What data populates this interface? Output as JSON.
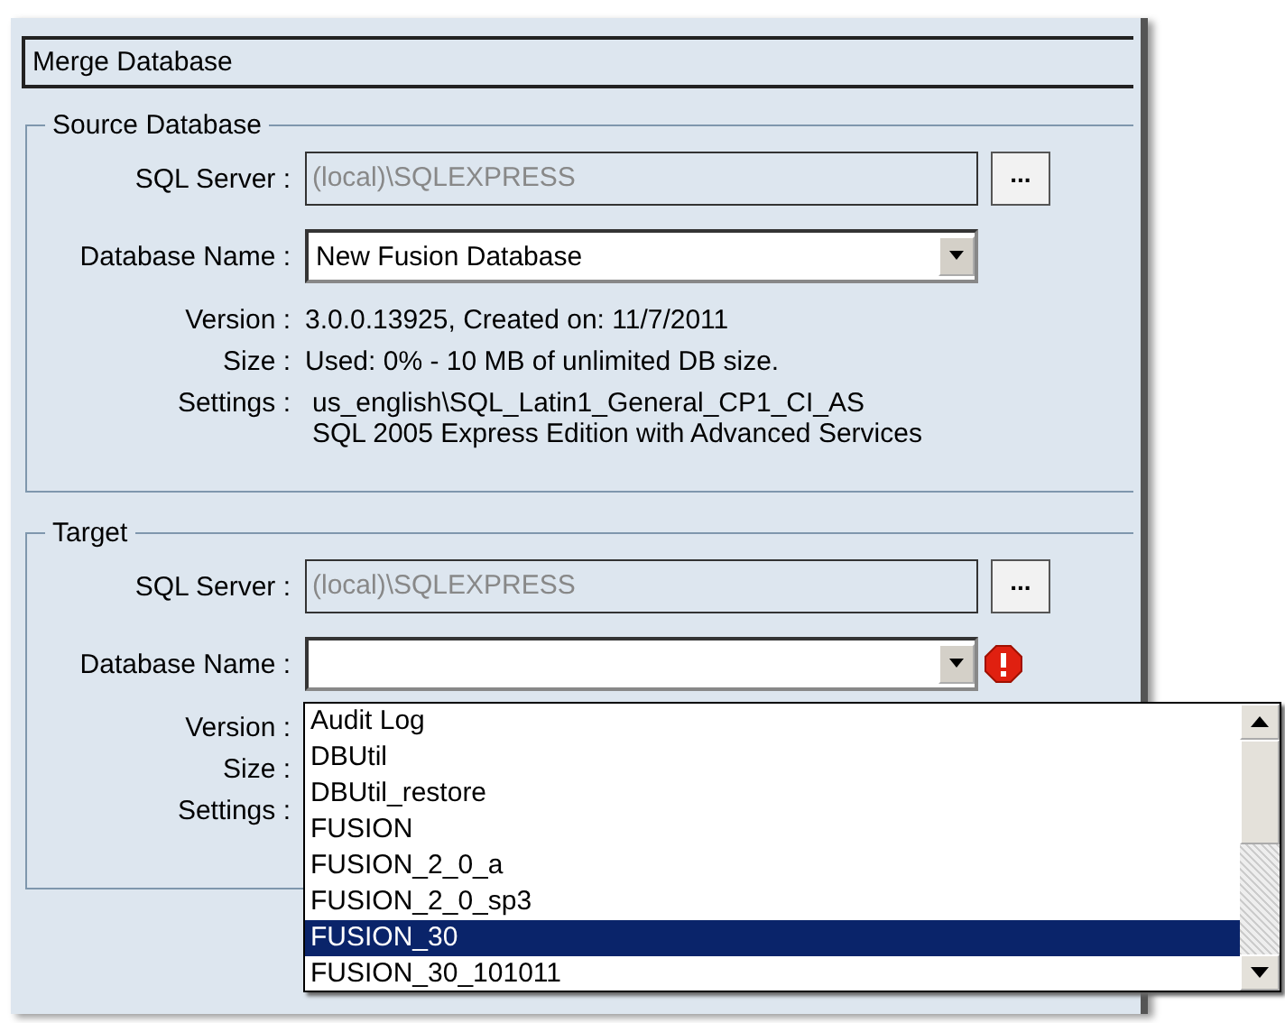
{
  "window": {
    "title": "Merge Database"
  },
  "groups": [
    {
      "legend": "Source Database",
      "server_label": "SQL Server :",
      "server": "(local)\\SQLEXPRESS",
      "browse": "...",
      "db_label": "Database Name :",
      "db": "New Fusion Database",
      "invalid": false,
      "details": [
        {
          "label": "Version :",
          "lines": [
            "3.0.0.13925, Created on: 11/7/2011"
          ]
        },
        {
          "label": "Size :",
          "lines": [
            "Used: 0% - 10 MB of unlimited DB size."
          ]
        },
        {
          "label": "Settings :",
          "lines": [
            "us_english\\SQL_Latin1_General_CP1_CI_AS",
            "SQL 2005 Express Edition with Advanced Services"
          ]
        }
      ]
    },
    {
      "legend": "Target",
      "server_label": "SQL Server :",
      "server": "(local)\\SQLEXPRESS",
      "browse": "...",
      "db_label": "Database Name :",
      "invalid": true,
      "details": [
        {
          "label": "Version :"
        },
        {
          "label": "Size :"
        },
        {
          "label": "Settings :"
        }
      ]
    }
  ],
  "dropdown": {
    "items": [
      {
        "label": "Audit Log",
        "selected": false
      },
      {
        "label": "DBUtil",
        "selected": false
      },
      {
        "label": "DBUtil_restore",
        "selected": false
      },
      {
        "label": "FUSION",
        "selected": false
      },
      {
        "label": "FUSION_2_0_a",
        "selected": false
      },
      {
        "label": "FUSION_2_0_sp3",
        "selected": false
      },
      {
        "label": "FUSION_30",
        "selected": true
      },
      {
        "label": "FUSION_30_101011",
        "selected": false
      }
    ]
  }
}
